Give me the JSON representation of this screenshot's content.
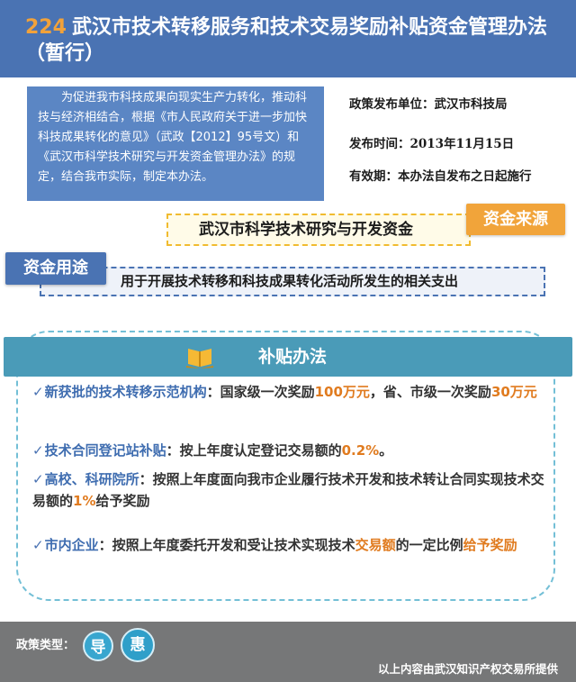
{
  "header": {
    "number": "224",
    "title": "武汉市技术转移服务和技术交易奖励补贴资金管理办法（暂行）"
  },
  "intro": "为促进我市科技成果向现实生产力转化，推动科技与经济相结合，根据《市人民政府关于进一步加快科技成果转化的意见》（武政【2012】95号文）和《武汉市科学技术研究与开发资金管理办法》的规定，结合我市实际，制定本办法。",
  "info": {
    "publisher": "政策发布单位：武汉市科技局",
    "date": "发布时间：2013年11月15日",
    "validity": "有效期：本办法自发布之日起施行"
  },
  "funding_source": {
    "tag": "资金来源",
    "text": "武汉市科学技术研究与开发资金"
  },
  "funding_use": {
    "tag": "资金用途",
    "text": "用于开展技术转移和科技成果转化活动所发生的相关支出"
  },
  "subsidy": {
    "title": "补贴办法",
    "icon": "book-icon",
    "check_mark": "✓",
    "items": [
      {
        "lead": "新获批的技术转移示范机构",
        "text_a": "：国家级一次奖励",
        "hl_a": "100万元",
        "text_b": "，省、市级一次奖励",
        "hl_b": "30万元"
      },
      {
        "lead": "技术合同登记站补贴",
        "text_a": "：按上年度认定登记交易额的",
        "hl_a": "0.2%",
        "text_b": "。"
      },
      {
        "lead": "高校、科研院所",
        "text_a": "：按照上年度面向我市企业履行技术开发和技术转让合同实现技术交易额的",
        "hl_a": "1%",
        "text_b": "给予奖励"
      },
      {
        "lead": "市内企业",
        "text_a": "：按照上年度委托开发和受让技术实现技术",
        "hl_a": "交易额",
        "text_b": "的一定比例",
        "hl_b": "给予奖励"
      }
    ]
  },
  "footer": {
    "type_label": "政策类型：",
    "types": [
      "导",
      "惠"
    ],
    "provider": "以上内容由武汉知识产权交易所提供"
  },
  "colors": {
    "header_blue": "#4a73b3",
    "accent_orange": "#f1a43a",
    "subsidy_teal": "#4a9bb8",
    "footer_gray": "#767778"
  }
}
